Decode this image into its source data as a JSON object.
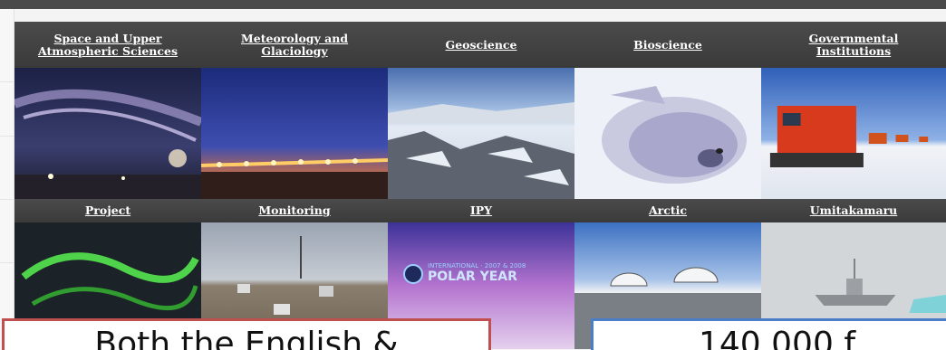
{
  "page": {
    "background_color": "#f4f4f4",
    "header_bar_color": "#4a4a4a",
    "link_color": "#ffffff"
  },
  "categories_row1": [
    {
      "label": "Space and Upper Atmospheric Sciences",
      "line1": "Space and Upper",
      "line2": "Atmospheric Sciences",
      "image": "aurora-night-sky"
    },
    {
      "label": "Meteorology and Glaciology",
      "line1": "Meteorology and",
      "line2": "Glaciology",
      "image": "twilight-station-lights"
    },
    {
      "label": "Geoscience",
      "line1": "Geoscience",
      "line2": "",
      "image": "rocky-snow-landscape"
    },
    {
      "label": "Bioscience",
      "line1": "Bioscience",
      "line2": "",
      "image": "seal-pup-on-ice"
    },
    {
      "label": "Governmental Institutions",
      "line1": "Governmental",
      "line2": "Institutions",
      "image": "red-snow-vehicle"
    }
  ],
  "categories_row2": [
    {
      "label": "Project",
      "image": "aurora-from-space"
    },
    {
      "label": "Monitoring",
      "image": "monitoring-station"
    },
    {
      "label": "IPY",
      "image": "polar-year-logo"
    },
    {
      "label": "Arctic",
      "image": "antenna-domes"
    },
    {
      "label": "Umitakamaru",
      "image": "ship-in-fog"
    }
  ],
  "ipy_logo": {
    "top_text": "INTERNATIONAL · 2007 & 2008",
    "main_text": "POLAR YEAR"
  },
  "notes": {
    "red_note": {
      "text": "Both the English &",
      "border_color": "#c05050"
    },
    "blue_note": {
      "text": "140,000 f",
      "border_color": "#4a7fc8"
    }
  }
}
